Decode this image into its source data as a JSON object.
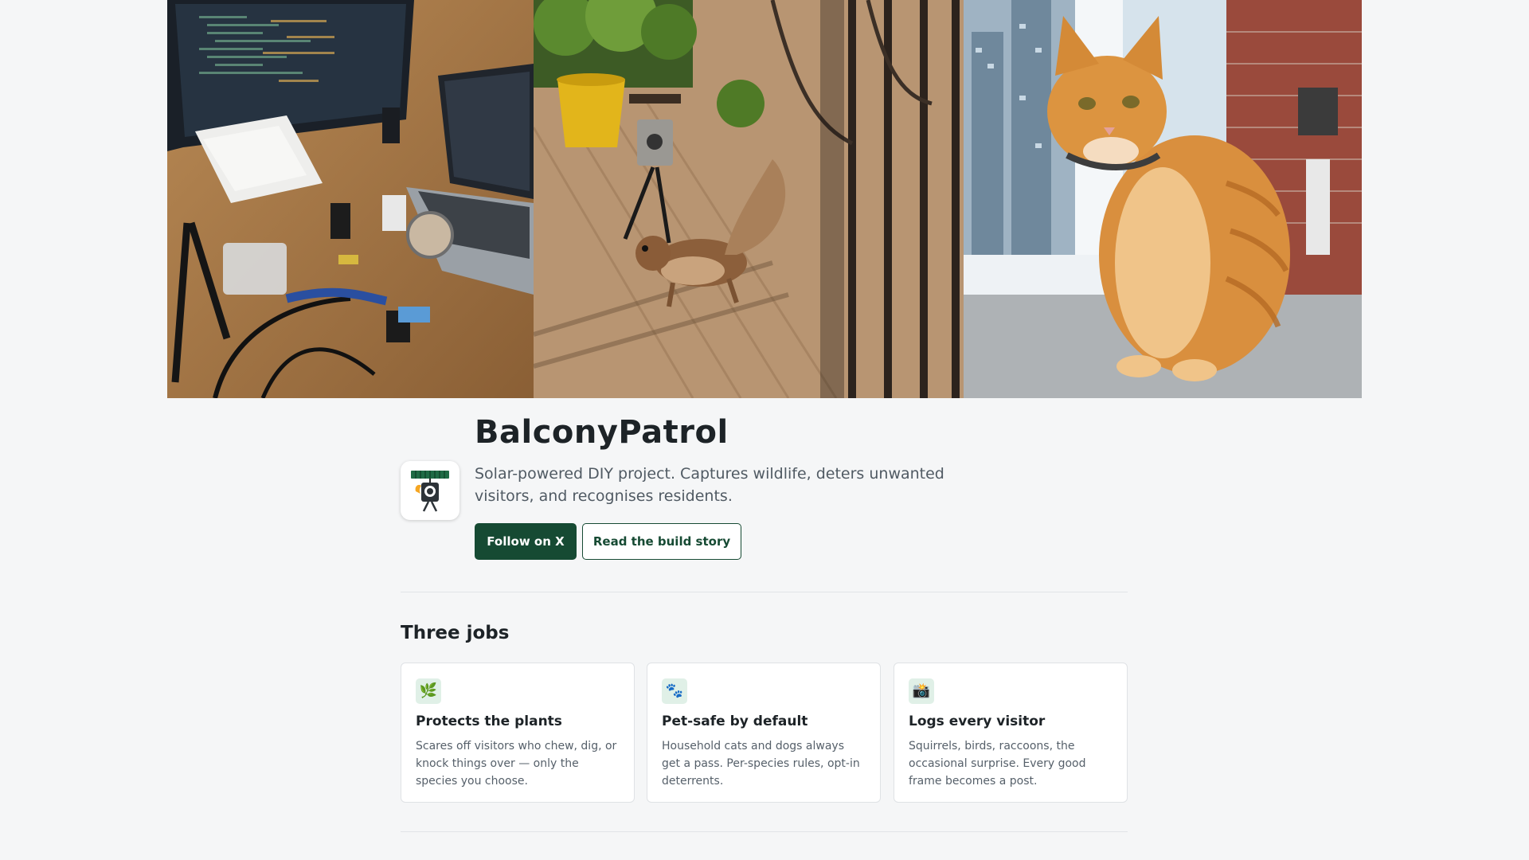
{
  "hero": {
    "panels": [
      "workbench photo",
      "squirrel on balcony photo",
      "orange cat photo"
    ]
  },
  "profile": {
    "logo_icon": "camera-tripod-solar-icon",
    "title": "BalconyPatrol",
    "tagline": "Solar-powered DIY project. Captures wildlife, deters unwanted visitors, and recognises residents.",
    "buttons": {
      "follow_label": "Follow on X",
      "story_label": "Read the build story"
    }
  },
  "section": {
    "title": "Three jobs",
    "cards": [
      {
        "icon": "🌿",
        "icon_name": "leaf-icon",
        "title": "Protects the plants",
        "description": "Scares off visitors who chew, dig, or knock things over — only the species you choose."
      },
      {
        "icon": "🐾",
        "icon_name": "paw-icon",
        "title": "Pet-safe by default",
        "description": "Household cats and dogs always get a pass. Per-species rules, opt-in deterrents."
      },
      {
        "icon": "📸",
        "icon_name": "camera-flash-icon",
        "title": "Logs every visitor",
        "description": "Squirrels, birds, raccoons, the occasional surprise. Every good frame becomes a post."
      }
    ]
  },
  "colors": {
    "page_bg": "#f5f6f7",
    "brand_green": "#164a33",
    "text_dark": "#1d2327",
    "text_muted": "#505a63",
    "icon_bg": "#e0f0e7"
  }
}
